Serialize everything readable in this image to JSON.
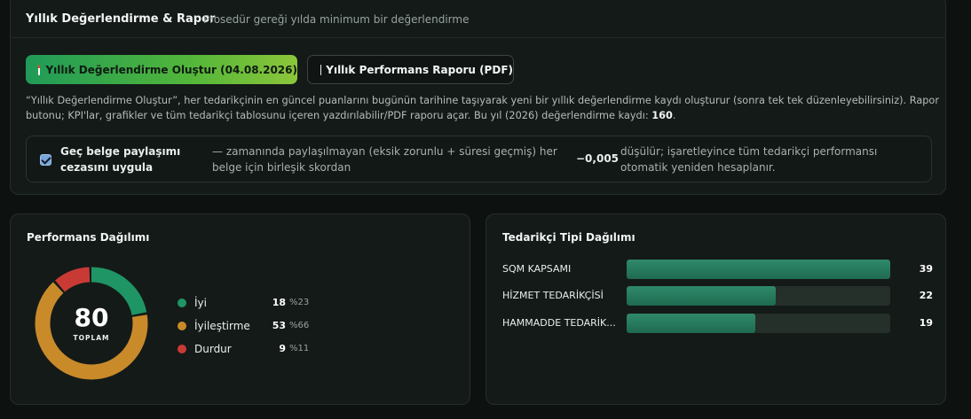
{
  "header": {
    "title": "Yıllık Değerlendirme & Rapor",
    "subtitle": "Prosedür gereği yılda minimum bir değerlendirme"
  },
  "actions": {
    "create_label": "Yıllık Değerlendirme Oluştur (04.08.2026)",
    "report_label": "Yıllık Performans Raporu (PDF)"
  },
  "description": {
    "text": "“Yıllık Değerlendirme Oluştur”, her tedarikçinin en güncel puanlarını bugünün tarihine taşıyarak yeni bir yıllık değerlendirme kaydı oluşturur (sonra tek tek düzenleyebilirsiniz). Rapor butonu; KPI'lar, grafikler ve tüm tedarikçi tablosunu içeren yazdırılabilir/PDF raporu açar. Bu yıl (2026) değerlendirme kaydı: ",
    "count": "160",
    "suffix": "."
  },
  "penalty": {
    "checked": true,
    "label": "Geç belge paylaşımı cezasını uygula",
    "description": "— zamanında paylaşılmayan (eksik zorunlu + süresi geçmiş) her belge için birleşik skordan",
    "value": "−0,005",
    "after": "düşülür; işaretleyince tüm tedarikçi performansı otomatik yeniden hesaplanır."
  },
  "performance": {
    "title": "Performans Dağılımı",
    "total": "80",
    "total_label": "TOPLAM",
    "items": [
      {
        "label": "İyi",
        "count": "18",
        "pct": "%23",
        "value": 18,
        "color": "#1f9565"
      },
      {
        "label": "İyileştirme",
        "count": "53",
        "pct": "%66",
        "value": 53,
        "color": "#c98a2a"
      },
      {
        "label": "Durdur",
        "count": "9",
        "pct": "%11",
        "value": 9,
        "color": "#c93a35"
      }
    ]
  },
  "supplier_types": {
    "title": "Tedarikçi Tipi Dağılımı",
    "max": 39,
    "items": [
      {
        "label": "SQM KAPSAMI",
        "value": "39",
        "amount": 39
      },
      {
        "label": "HİZMET TEDARİKÇİSİ",
        "value": "22",
        "amount": 22
      },
      {
        "label": "HAMMADDE TEDARİK...",
        "value": "19",
        "amount": 19
      }
    ]
  }
}
